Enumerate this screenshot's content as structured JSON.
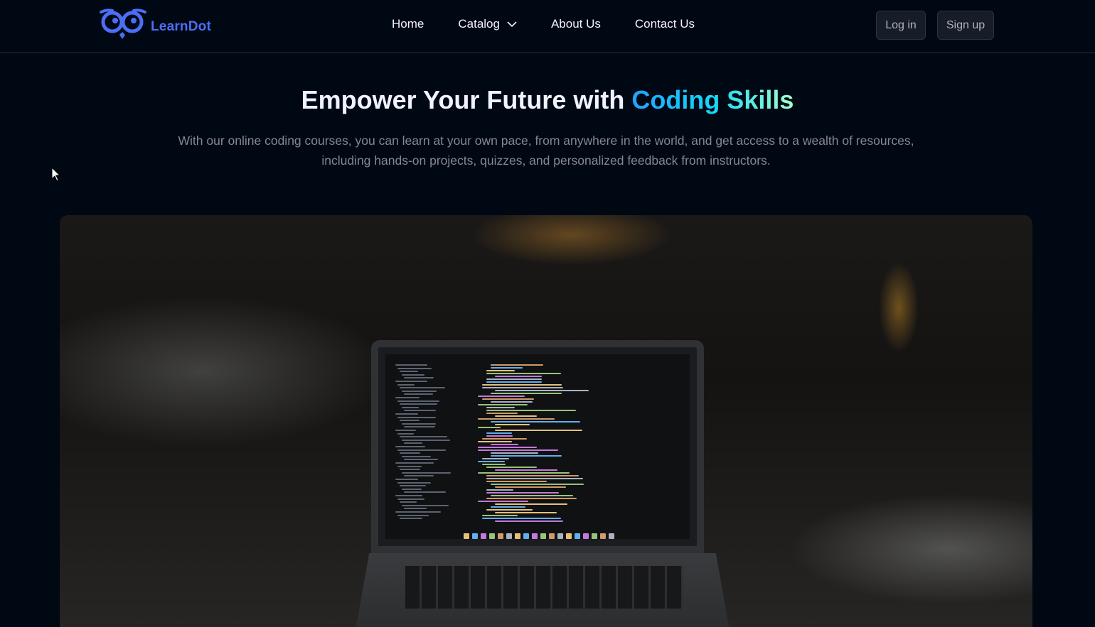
{
  "brand": {
    "name": "LearnDot",
    "color": "#4c6ef5",
    "logo_icon": "owl-glasses-icon"
  },
  "nav": {
    "home": "Home",
    "catalog": "Catalog",
    "about": "About Us",
    "contact": "Contact Us"
  },
  "auth": {
    "login": "Log in",
    "signup": "Sign up"
  },
  "hero": {
    "title_prefix": "Empower Your Future with",
    "title_highlight": "Coding Skills",
    "subtitle": "With our online coding courses, you can learn at your own pace, from anywhere in the world, and get access to a wealth of resources, including hands-on projects, quizzes, and personalized feedback from instructors."
  },
  "colors": {
    "background": "#000814",
    "text": "#f1f2ff",
    "muted": "#838894",
    "highlight_gradient": [
      "#1fa2ff",
      "#12d8fa",
      "#a6ffcb"
    ]
  }
}
